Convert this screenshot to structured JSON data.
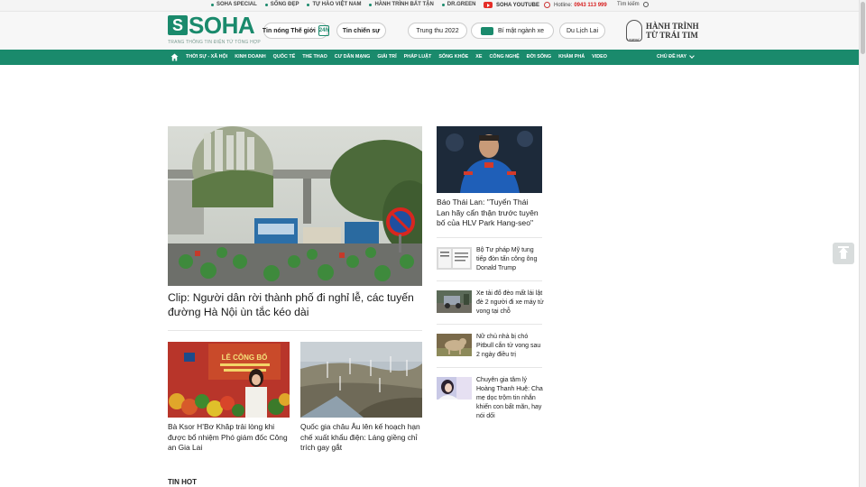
{
  "topbar": {
    "links": [
      "SOHA SPECIAL",
      "SỐNG ĐẸP",
      "TỰ HÀO VIỆT NAM",
      "HÀNH TRÌNH BẤT TẬN",
      "DR.GREEN"
    ],
    "youtube": "SOHA YOUTUBE",
    "hotline_label": "Hotline:",
    "hotline_number": "0943 113 999",
    "search": "Tìm kiếm"
  },
  "header": {
    "logo_letter": "S",
    "logo_word": "SOHA",
    "tagline": "TRANG THÔNG TIN ĐIỆN TỬ TỔNG HỢP",
    "pills": {
      "hot_world": "Tin nóng Thế giới",
      "hot_world_badge": "24h",
      "war_news": "Tin chiến sự",
      "trung_thu": "Trung thu 2022",
      "car_secret": "Bí mật ngành xe",
      "travel": "Du Lịch Lai"
    },
    "legend_badge": "Legend",
    "legend_line1": "HÀNH TRÌNH",
    "legend_line2": "TỪ TRÁI TIM"
  },
  "nav": {
    "items": [
      "THỜI SỰ - XÃ HỘI",
      "KINH DOANH",
      "QUỐC TẾ",
      "THỂ THAO",
      "CƯ DÂN MẠNG",
      "GIẢI TRÍ",
      "PHÁP LUẬT",
      "SỐNG KHỎE",
      "XE",
      "CÔNG NGHỆ",
      "ĐỜI SỐNG",
      "KHÁM PHÁ",
      "VIDEO"
    ],
    "more": "CHỦ ĐỀ HAY"
  },
  "main": {
    "lead_title": "Clip: Người dân rời thành phố đi nghỉ lễ, các tuyến đường Hà Nội ùn tắc kéo dài",
    "sub_stories": [
      "Bà Ksor H’Bơ Khăp trải lòng khi được bổ nhiệm Phó giám đốc Công an Gia Lai",
      "Quốc gia châu Âu lên kế hoạch hạn chế xuất khẩu điện: Láng giềng chỉ trích gay gắt"
    ],
    "sidebar_top": "Báo Thái Lan: \"Tuyển Thái Lan hãy cẩn thận trước tuyên bố của HLV Park Hang-seo\"",
    "sidebar_items": [
      "Bộ Tư pháp Mỹ tung tiếp đòn tấn công ông Donald Trump",
      "Xe tải đổ đèo mất lái lật đè 2 người đi xe máy tử vong tại chỗ",
      "Nữ chủ nhà bị chó Pitbull cắn tử vong sau 2 ngày điều trị",
      "Chuyên gia tâm lý Hoàng Thanh Huệ: Cha mẹ dọc trộm tin nhắn khiến con bất mãn, hay nói dối"
    ],
    "img_caption_card": "LỄ CÔNG BỐ",
    "section_hot": "TIN HOT"
  },
  "colors": {
    "brand": "#1a8a6c",
    "hotline": "#d71e1e"
  }
}
